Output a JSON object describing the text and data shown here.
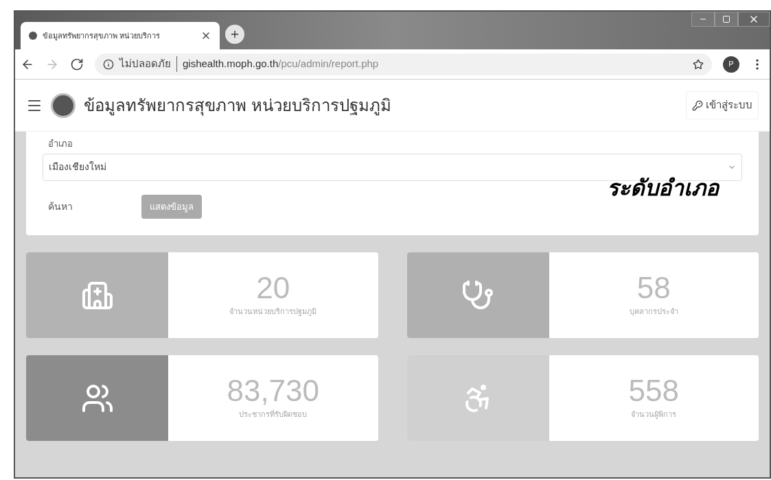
{
  "browser": {
    "tab_title": "ข้อมูลทรัพยากรสุขภาพ หน่วยบริการ",
    "security": "ไม่ปลอดภัย",
    "url_host": "gishealth.moph.go.th",
    "url_path": "/pcu/admin/report.php",
    "profile": "P"
  },
  "header": {
    "title": "ข้อมูลทรัพยากรสุขภาพ หน่วยบริการปฐมภูมิ",
    "login": "เข้าสู่ระบบ"
  },
  "form": {
    "district_label": "อำเภอ",
    "district_value": "เมืองเชียงใหม่",
    "search_label": "ค้นหา",
    "show_button": "แสดงข้อมูล",
    "show_disabled": true
  },
  "annotation": "ระดับอำเภอ",
  "stats": [
    {
      "kind": "hospital",
      "color": "#b3b3b3",
      "value": "20",
      "label": "จำนวนหน่วยบริการปฐมภูมิ"
    },
    {
      "kind": "doctor",
      "color": "#b0b0b0",
      "value": "58",
      "label": "บุคลากรประจำ"
    },
    {
      "kind": "people",
      "color": "#8c8c8c",
      "value": "83,730",
      "label": "ประชากรที่รับผิดชอบ"
    },
    {
      "kind": "wheelchair",
      "color": "#d0d0d0",
      "value": "558",
      "label": "จำนวนผู้พิการ"
    }
  ]
}
